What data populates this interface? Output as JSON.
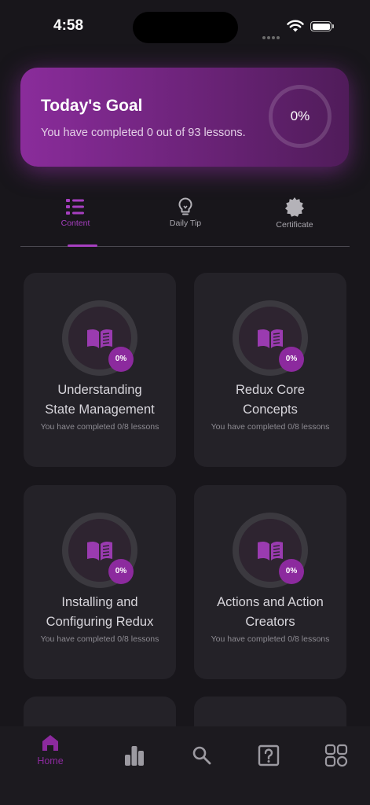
{
  "status_bar": {
    "time": "4:58"
  },
  "goal_card": {
    "title": "Today's Goal",
    "subtitle": "You have completed 0 out of 93 lessons.",
    "progress_label": "0%",
    "progress": 0
  },
  "tabs": [
    {
      "label": "Content",
      "icon": "list-icon",
      "active": true
    },
    {
      "label": "Daily Tip",
      "icon": "lightbulb-icon",
      "active": false
    },
    {
      "label": "Certificate",
      "icon": "badge-icon",
      "active": false
    }
  ],
  "cards": [
    {
      "title_line1": "Understanding",
      "title_line2": "State Management",
      "progress_label": "0%",
      "subtitle": "You have completed 0/8 lessons"
    },
    {
      "title_line1": "Redux Core",
      "title_line2": "Concepts",
      "progress_label": "0%",
      "subtitle": "You have completed 0/8 lessons"
    },
    {
      "title_line1": "Installing and",
      "title_line2": "Configuring Redux",
      "progress_label": "0%",
      "subtitle": "You have completed 0/8 lessons"
    },
    {
      "title_line1": "Actions and Action",
      "title_line2": "Creators",
      "progress_label": "0%",
      "subtitle": "You have completed 0/8 lessons"
    }
  ],
  "bottom_nav": [
    {
      "label": "Home",
      "icon": "home-icon",
      "active": true
    },
    {
      "label": "",
      "icon": "bar-chart-icon",
      "active": false
    },
    {
      "label": "",
      "icon": "search-icon",
      "active": false
    },
    {
      "label": "",
      "icon": "help-icon",
      "active": false
    },
    {
      "label": "",
      "icon": "grid-icon",
      "active": false
    }
  ],
  "colors": {
    "background": "#18161b",
    "accent": "#a63fc0",
    "card": "#242228",
    "goal_gradient_start": "#8a2c9b",
    "goal_gradient_end": "#501c5a"
  }
}
